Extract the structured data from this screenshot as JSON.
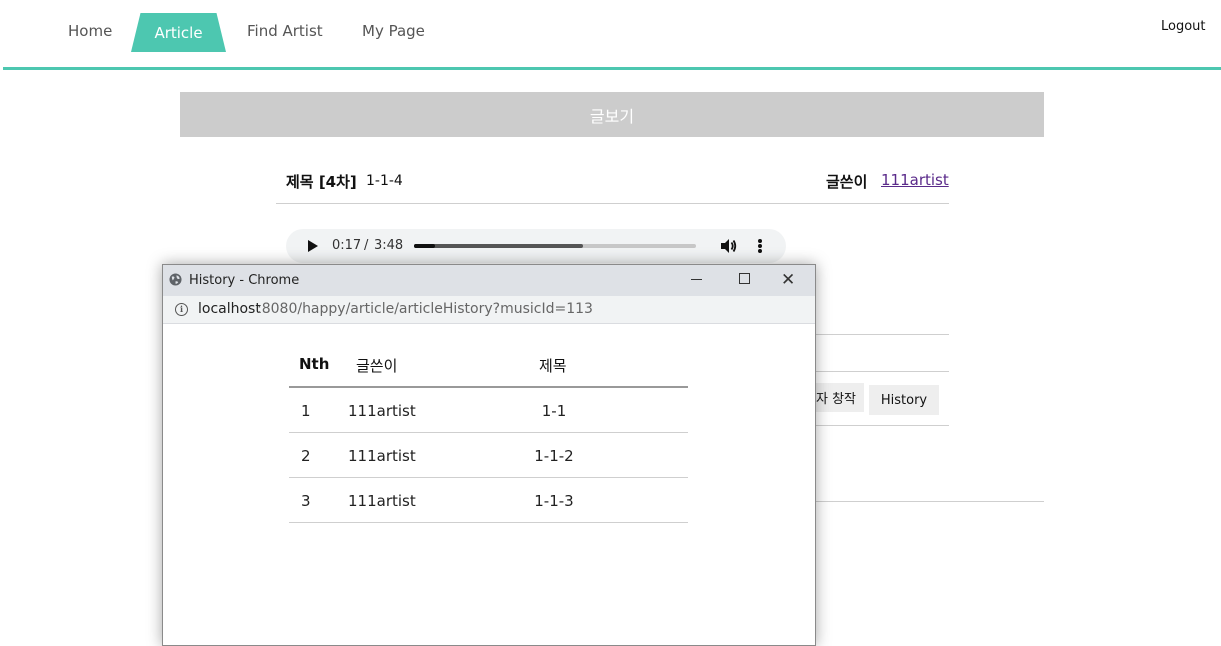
{
  "nav": {
    "items": [
      "Home",
      "Article",
      "Find Artist",
      "My Page"
    ],
    "active": "Article",
    "logout": "Logout"
  },
  "band": {
    "title": "글보기"
  },
  "article": {
    "title_label": "제목 [4차]",
    "title_value": "1-1-4",
    "author_label": "글쓴이",
    "author_value": "111artist"
  },
  "player": {
    "current_time": "0:17",
    "separator": "/",
    "duration": "3:48",
    "progress_fraction": 0.075,
    "buffered_fraction": 0.6
  },
  "buttons": {
    "create_partial": "자 창작",
    "history": "History"
  },
  "popup": {
    "window_title": "History - Chrome",
    "url_host": "localhost",
    "url_rest": ":8080/happy/article/articleHistory?musicId=113",
    "columns": [
      "Nth",
      "글쓴이",
      "제목"
    ],
    "rows": [
      {
        "nth": "1",
        "author": "111artist",
        "title": "1-1"
      },
      {
        "nth": "2",
        "author": "111artist",
        "title": "1-1-2"
      },
      {
        "nth": "3",
        "author": "111artist",
        "title": "1-1-3"
      }
    ]
  },
  "colors": {
    "accent": "#4dc7b0",
    "band": "#cccccc",
    "link_visited": "#5a2a8a"
  }
}
